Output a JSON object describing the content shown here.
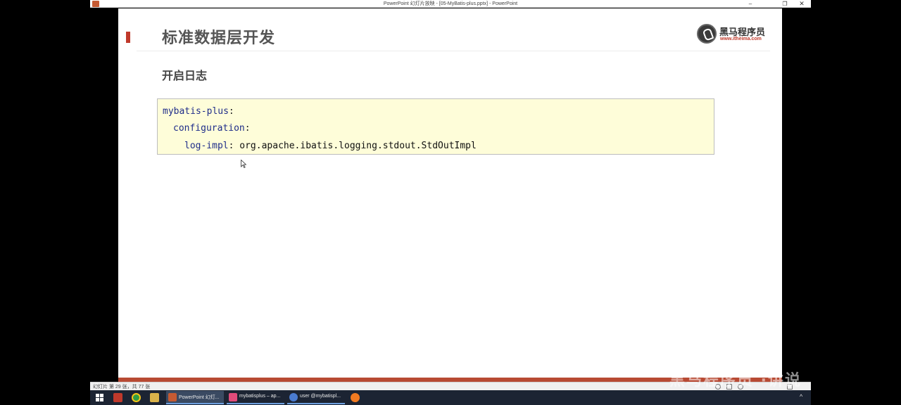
{
  "window": {
    "title": "PowerPoint 幻灯片放映 - [05-MyBatis-plus.pptx] - PowerPoint",
    "minimize": "–",
    "maximize": "❐",
    "close": "✕"
  },
  "slide": {
    "title": "标准数据层开发",
    "section_heading": "开启日志",
    "logo": {
      "name_cn": "黑马程序员",
      "url": "www.itheima.com"
    },
    "code": {
      "line1_key": "mybatis-plus",
      "line2_key": "configuration",
      "line3_key": "log-impl",
      "colon": ":",
      "line3_value": "org.apache.ibatis.logging.stdout.StdOutImpl"
    }
  },
  "statusbar": {
    "slide_counter": "幻灯片 第 29 张，共 77 张"
  },
  "watermark": "黑马程序员 ·讲说",
  "taskbar": {
    "apps": [
      {
        "label": "PowerPoint 幻灯...",
        "icon": "powerpoint-icon",
        "color": "#c55a32"
      },
      {
        "label": "mybatisplus – ap...",
        "icon": "intellij-icon",
        "color": "#e14b7a"
      },
      {
        "label": "user @mybatispl...",
        "icon": "datagrip-icon",
        "color": "#4a7bd0"
      }
    ],
    "tray_caret": "^"
  },
  "colors": {
    "accent": "#c0392b",
    "code_background": "#fefdd9",
    "code_key": "#1f2d8a",
    "bottom_band": "#b84a33",
    "taskbar": "#1c2433"
  }
}
